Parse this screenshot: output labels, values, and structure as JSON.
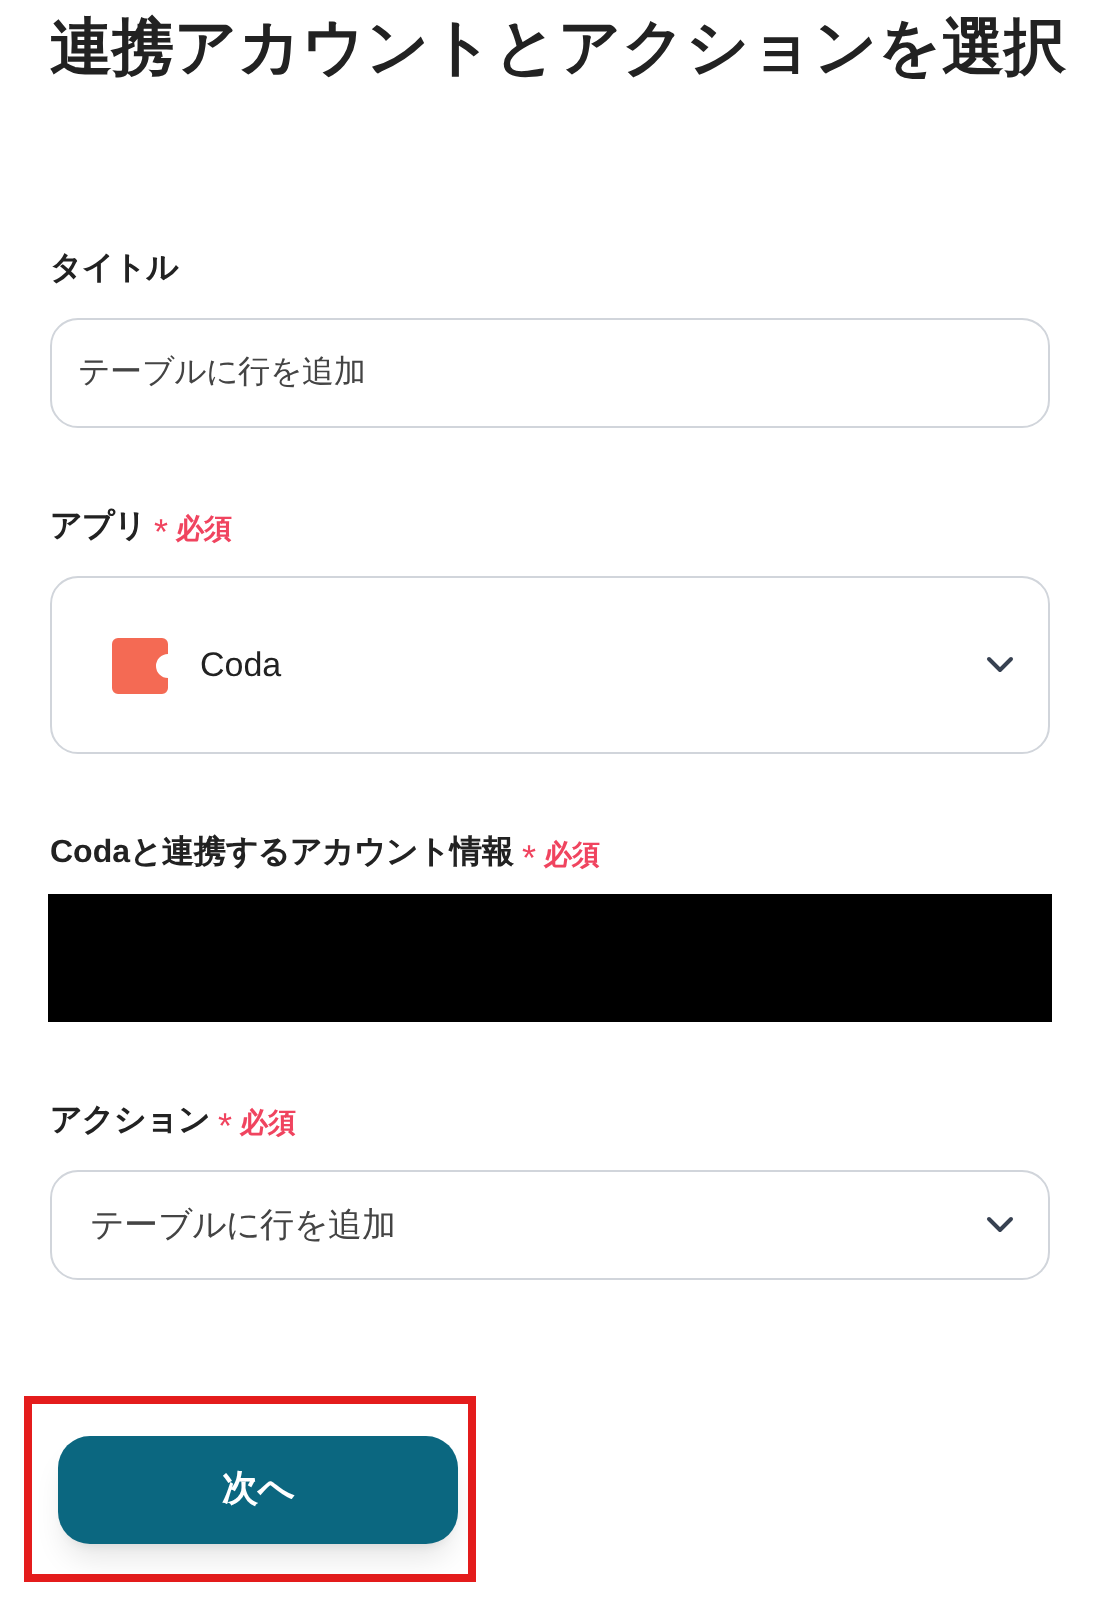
{
  "heading": "連携アカウントとアクションを選択",
  "fields": [
    {
      "kind": "text",
      "label": "タイトル",
      "value": "テーブルに行を追加"
    },
    {
      "kind": "app_select",
      "label": "アプリ",
      "required": true,
      "required_mark": "*",
      "required_text": "必須",
      "value": "Coda"
    },
    {
      "kind": "redacted",
      "label": "Codaと連携するアカウント情報",
      "required": true,
      "required_mark": "*",
      "required_text": "必須"
    },
    {
      "kind": "select",
      "label": "アクション",
      "required": true,
      "required_mark": "*",
      "required_text": "必須",
      "value": "テーブルに行を追加"
    }
  ],
  "next_button": {
    "label": "次へ",
    "highlighted": true
  }
}
